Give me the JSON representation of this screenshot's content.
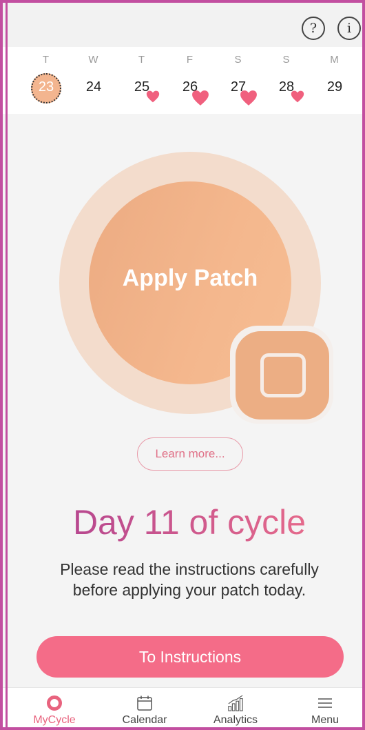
{
  "header": {
    "help_glyph": "?",
    "info_glyph": "i"
  },
  "week": {
    "days": [
      {
        "dow": "T",
        "date": "23",
        "today": true,
        "heart": false
      },
      {
        "dow": "W",
        "date": "24",
        "today": false,
        "heart": false
      },
      {
        "dow": "T",
        "date": "25",
        "today": false,
        "heart": true
      },
      {
        "dow": "F",
        "date": "26",
        "today": false,
        "heart": true
      },
      {
        "dow": "S",
        "date": "27",
        "today": false,
        "heart": true
      },
      {
        "dow": "S",
        "date": "28",
        "today": false,
        "heart": true
      },
      {
        "dow": "M",
        "date": "29",
        "today": false,
        "heart": false
      }
    ]
  },
  "main": {
    "action_label": "Apply Patch",
    "learn_more": "Learn more...",
    "cycle_day": "Day 11 of cycle",
    "instructions_line1": "Please read the instructions carefully",
    "instructions_line2": "before applying your patch today.",
    "to_instructions": "To Instructions"
  },
  "nav": {
    "items": [
      {
        "label": "MyCycle",
        "icon": "cycle-dot-icon",
        "active": true
      },
      {
        "label": "Calendar",
        "icon": "calendar-icon",
        "active": false
      },
      {
        "label": "Analytics",
        "icon": "bar-chart-icon",
        "active": false
      },
      {
        "label": "Menu",
        "icon": "hamburger-menu-icon",
        "active": false
      }
    ]
  },
  "colors": {
    "accent_pink": "#f46c88",
    "frame_magenta": "#c24fa0",
    "peach": "#f4b78d",
    "heart": "#f0607e"
  }
}
